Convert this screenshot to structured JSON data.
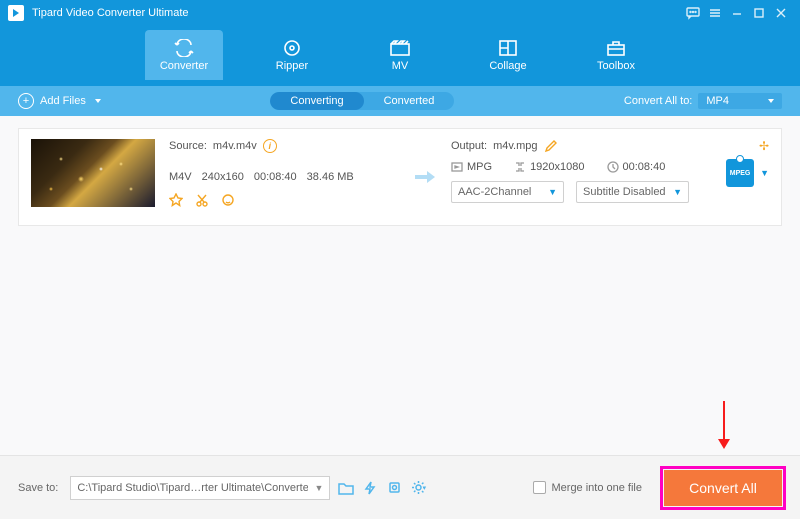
{
  "title": "Tipard Video Converter Ultimate",
  "nav": {
    "converter": "Converter",
    "ripper": "Ripper",
    "mv": "MV",
    "collage": "Collage",
    "toolbox": "Toolbox"
  },
  "sub": {
    "add_files": "Add Files",
    "converting": "Converting",
    "converted": "Converted",
    "convert_to": "Convert All to:",
    "format": "MP4"
  },
  "item": {
    "source_label": "Source:",
    "source_file": "m4v.m4v",
    "ext": "M4V",
    "res": "240x160",
    "duration": "00:08:40",
    "size": "38.46 MB",
    "out_label": "Output:",
    "out_file": "m4v.mpg",
    "out_ext": "MPG",
    "out_res": "1920x1080",
    "out_duration": "00:08:40",
    "audio": "AAC-2Channel",
    "subtitle": "Subtitle Disabled",
    "format_badge": "MPEG"
  },
  "bottom": {
    "save_to": "Save to:",
    "path": "C:\\Tipard Studio\\Tipard…rter Ultimate\\Converted",
    "merge": "Merge into one file",
    "convert": "Convert All"
  }
}
